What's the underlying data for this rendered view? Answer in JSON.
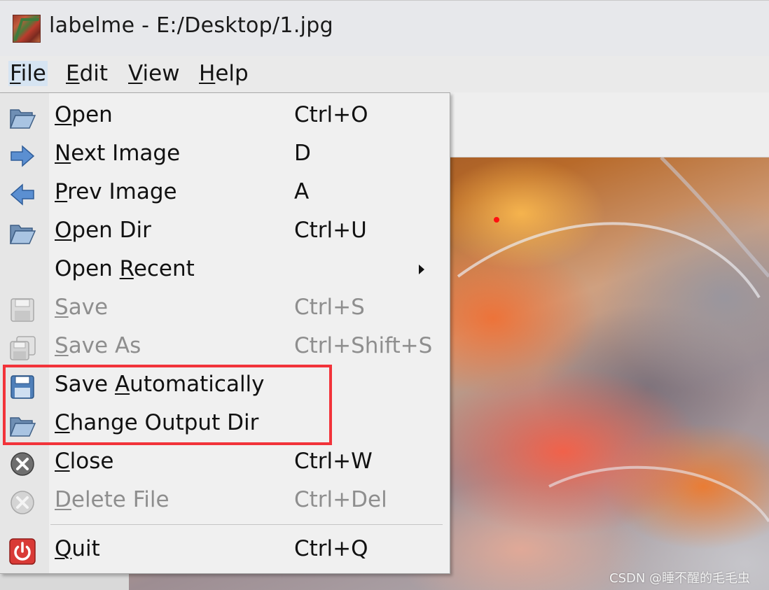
{
  "window": {
    "title": "labelme - E:/Desktop/1.jpg"
  },
  "menubar": {
    "items": [
      {
        "label_u": "F",
        "label_rest": "ile"
      },
      {
        "label_u": "E",
        "label_rest": "dit"
      },
      {
        "label_u": "V",
        "label_rest": "iew"
      },
      {
        "label_u": "H",
        "label_rest": "elp"
      }
    ]
  },
  "file_menu": {
    "items": [
      {
        "pre": "",
        "u": "O",
        "post": "pen",
        "shortcut": "Ctrl+O",
        "icon": "folder-open-icon",
        "enabled": true
      },
      {
        "pre": "",
        "u": "N",
        "post": "ext Image",
        "shortcut": "D",
        "icon": "arrow-right-icon",
        "enabled": true
      },
      {
        "pre": "",
        "u": "P",
        "post": "rev Image",
        "shortcut": "A",
        "icon": "arrow-left-icon",
        "enabled": true
      },
      {
        "pre": "",
        "u": "O",
        "post": "pen Dir",
        "shortcut": "Ctrl+U",
        "icon": "folder-open-icon",
        "enabled": true
      },
      {
        "pre": "Open ",
        "u": "R",
        "post": "ecent",
        "shortcut": "",
        "icon": "",
        "enabled": true,
        "submenu": true
      },
      {
        "pre": "",
        "u": "S",
        "post": "ave",
        "shortcut": "Ctrl+S",
        "icon": "floppy-disk-icon",
        "enabled": false
      },
      {
        "pre": "",
        "u": "S",
        "post": "ave As",
        "shortcut": "Ctrl+Shift+S",
        "icon": "floppy-disks-icon",
        "enabled": false
      },
      {
        "pre": "Save ",
        "u": "A",
        "post": "utomatically",
        "shortcut": "",
        "icon": "floppy-disk-icon",
        "enabled": true
      },
      {
        "pre": "",
        "u": "C",
        "post": "hange Output Dir",
        "shortcut": "",
        "icon": "folder-open-icon",
        "enabled": true
      },
      {
        "pre": "",
        "u": "C",
        "post": "lose",
        "shortcut": "Ctrl+W",
        "icon": "close-circle-icon",
        "enabled": true
      },
      {
        "pre": "",
        "u": "D",
        "post": "elete File",
        "shortcut": "Ctrl+Del",
        "icon": "close-circle-icon",
        "enabled": false
      },
      {
        "pre": "",
        "u": "Q",
        "post": "uit",
        "shortcut": "Ctrl+Q",
        "icon": "power-icon",
        "enabled": true
      }
    ]
  },
  "colors": {
    "highlight": "#f2333a",
    "menu_bg": "#f0f0f0"
  },
  "watermark": "CSDN @睡不醒的毛毛虫"
}
